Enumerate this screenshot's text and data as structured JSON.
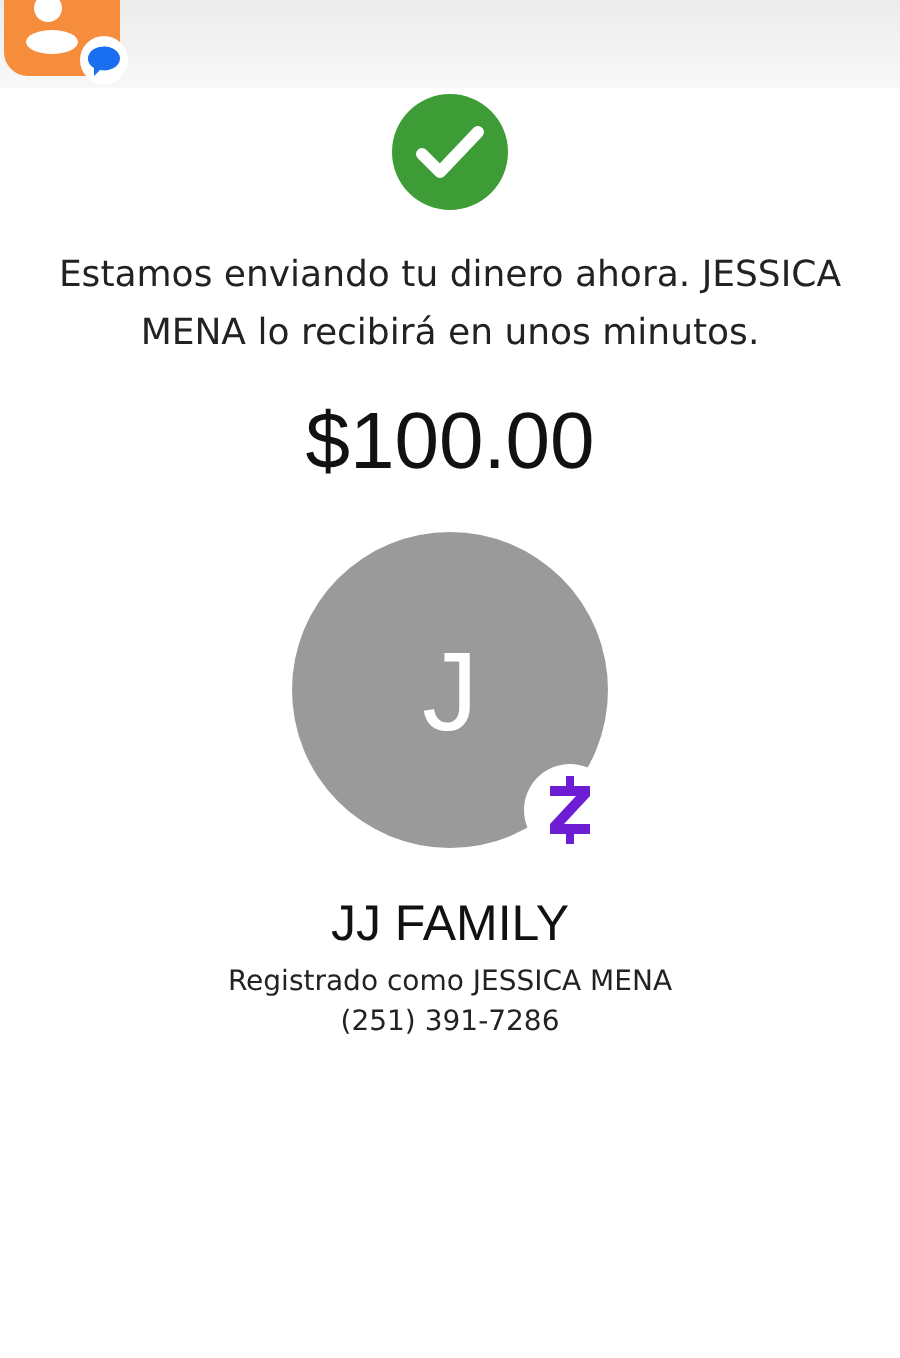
{
  "message": "Estamos enviando tu dinero ahora. JESSICA MENA lo recibirá en unos minutos.",
  "amount": "$100.00",
  "recipient": {
    "initial": "J",
    "name": "JJ FAMILY",
    "registered_as": "Registrado como JESSICA MENA",
    "phone": "(251) 391-7286"
  }
}
